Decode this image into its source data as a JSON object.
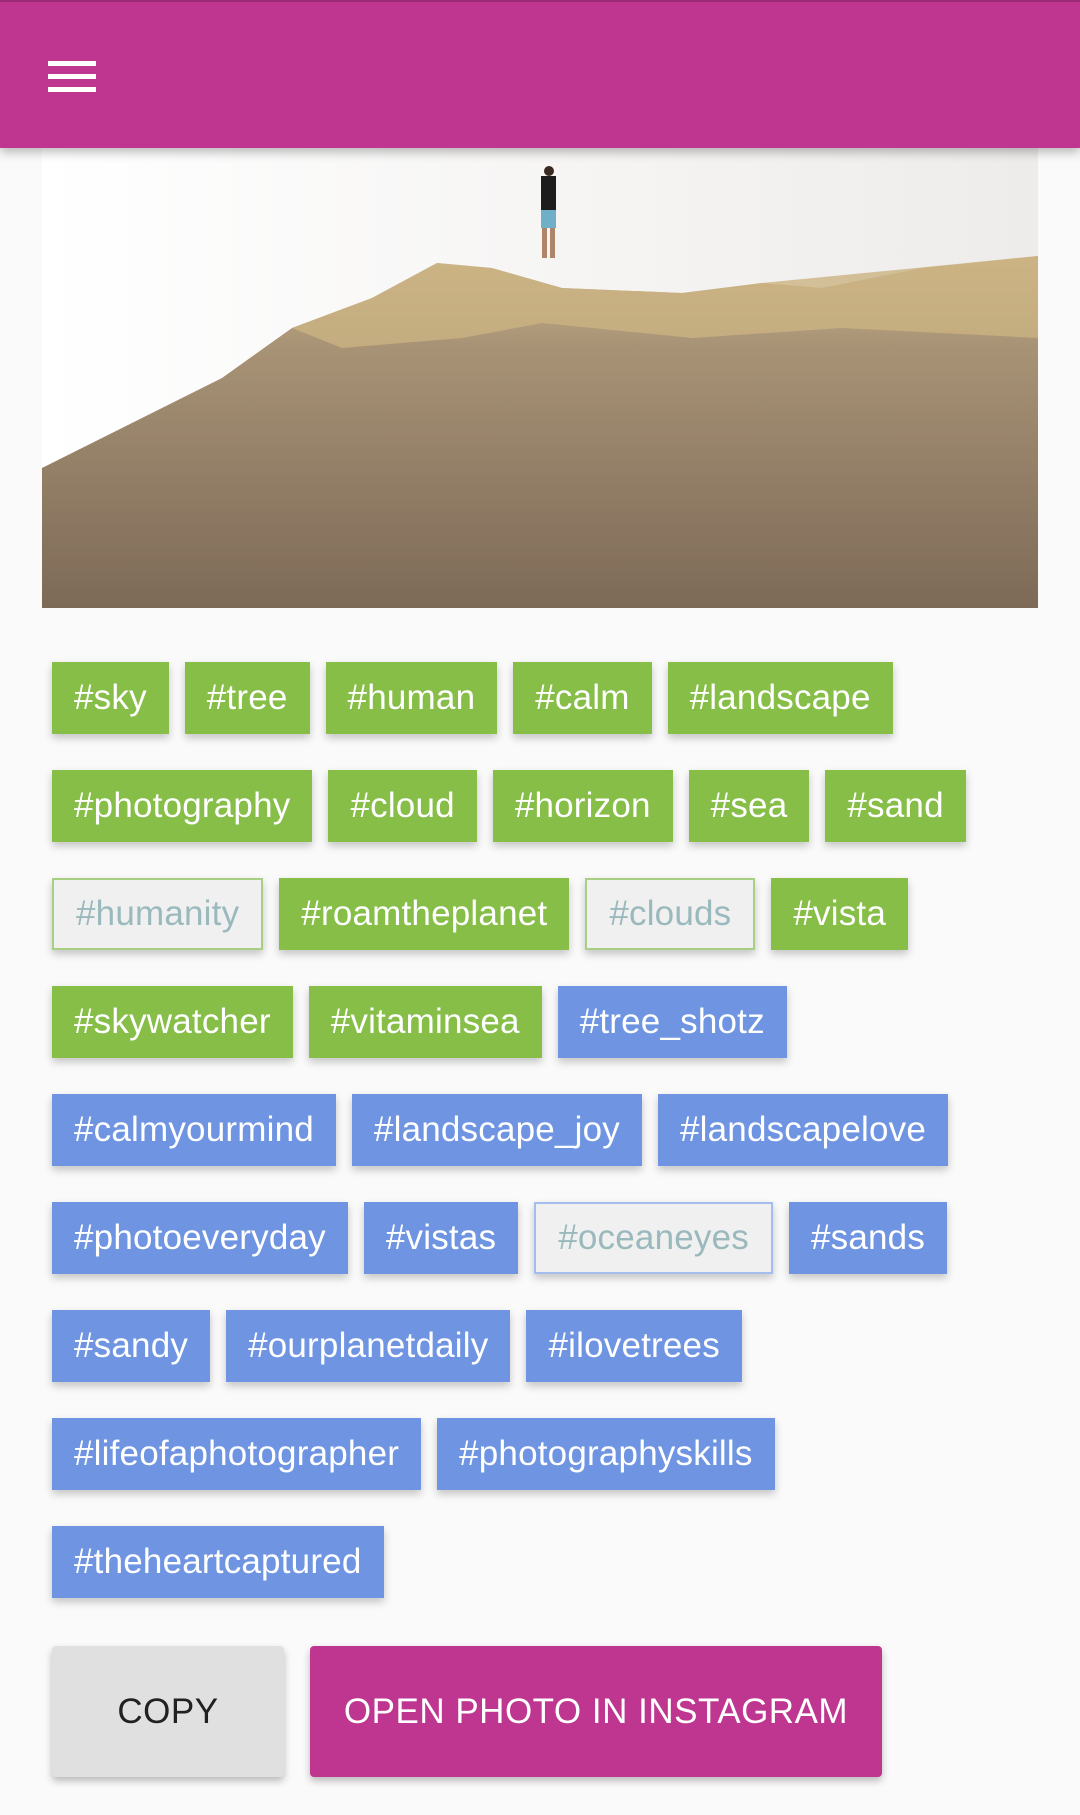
{
  "appbar": {
    "menu_icon": "hamburger-menu-icon",
    "color": "#be3690"
  },
  "photo": {
    "alt": "Person standing on top of a sandy rock hill against a white sky"
  },
  "colors": {
    "green": "#86be48",
    "blue": "#6f94e1",
    "deselected_bg": "#f0f0f0",
    "deselected_text": "#9ab9bd",
    "accent": "#be3690"
  },
  "tags": [
    {
      "label": "#sky",
      "group": "green",
      "selected": true
    },
    {
      "label": "#tree",
      "group": "green",
      "selected": true
    },
    {
      "label": "#human",
      "group": "green",
      "selected": true
    },
    {
      "label": "#calm",
      "group": "green",
      "selected": true
    },
    {
      "label": "#landscape",
      "group": "green",
      "selected": true
    },
    {
      "label": "#photography",
      "group": "green",
      "selected": true
    },
    {
      "label": "#cloud",
      "group": "green",
      "selected": true
    },
    {
      "label": "#horizon",
      "group": "green",
      "selected": true
    },
    {
      "label": "#sea",
      "group": "green",
      "selected": true
    },
    {
      "label": "#sand",
      "group": "green",
      "selected": true
    },
    {
      "label": "#humanity",
      "group": "green",
      "selected": false
    },
    {
      "label": "#roamtheplanet",
      "group": "green",
      "selected": true
    },
    {
      "label": "#clouds",
      "group": "green",
      "selected": false
    },
    {
      "label": "#vista",
      "group": "green",
      "selected": true
    },
    {
      "label": "#skywatcher",
      "group": "green",
      "selected": true
    },
    {
      "label": "#vitaminsea",
      "group": "green",
      "selected": true
    },
    {
      "label": "#tree_shotz",
      "group": "blue",
      "selected": true
    },
    {
      "label": "#calmyourmind",
      "group": "blue",
      "selected": true
    },
    {
      "label": "#landscape_joy",
      "group": "blue",
      "selected": true
    },
    {
      "label": "#landscapelove",
      "group": "blue",
      "selected": true
    },
    {
      "label": "#photoeveryday",
      "group": "blue",
      "selected": true
    },
    {
      "label": "#vistas",
      "group": "blue",
      "selected": true
    },
    {
      "label": "#oceaneyes",
      "group": "blue",
      "selected": false
    },
    {
      "label": "#sands",
      "group": "blue",
      "selected": true
    },
    {
      "label": "#sandy",
      "group": "blue",
      "selected": true
    },
    {
      "label": "#ourplanetdaily",
      "group": "blue",
      "selected": true
    },
    {
      "label": "#ilovetrees",
      "group": "blue",
      "selected": true
    },
    {
      "label": "#lifeofaphotographer",
      "group": "blue",
      "selected": true
    },
    {
      "label": "#photographyskills",
      "group": "blue",
      "selected": true
    },
    {
      "label": "#theheartcaptured",
      "group": "blue",
      "selected": true
    }
  ],
  "actions": {
    "copy_label": "COPY",
    "open_label": "OPEN PHOTO IN INSTAGRAM"
  }
}
